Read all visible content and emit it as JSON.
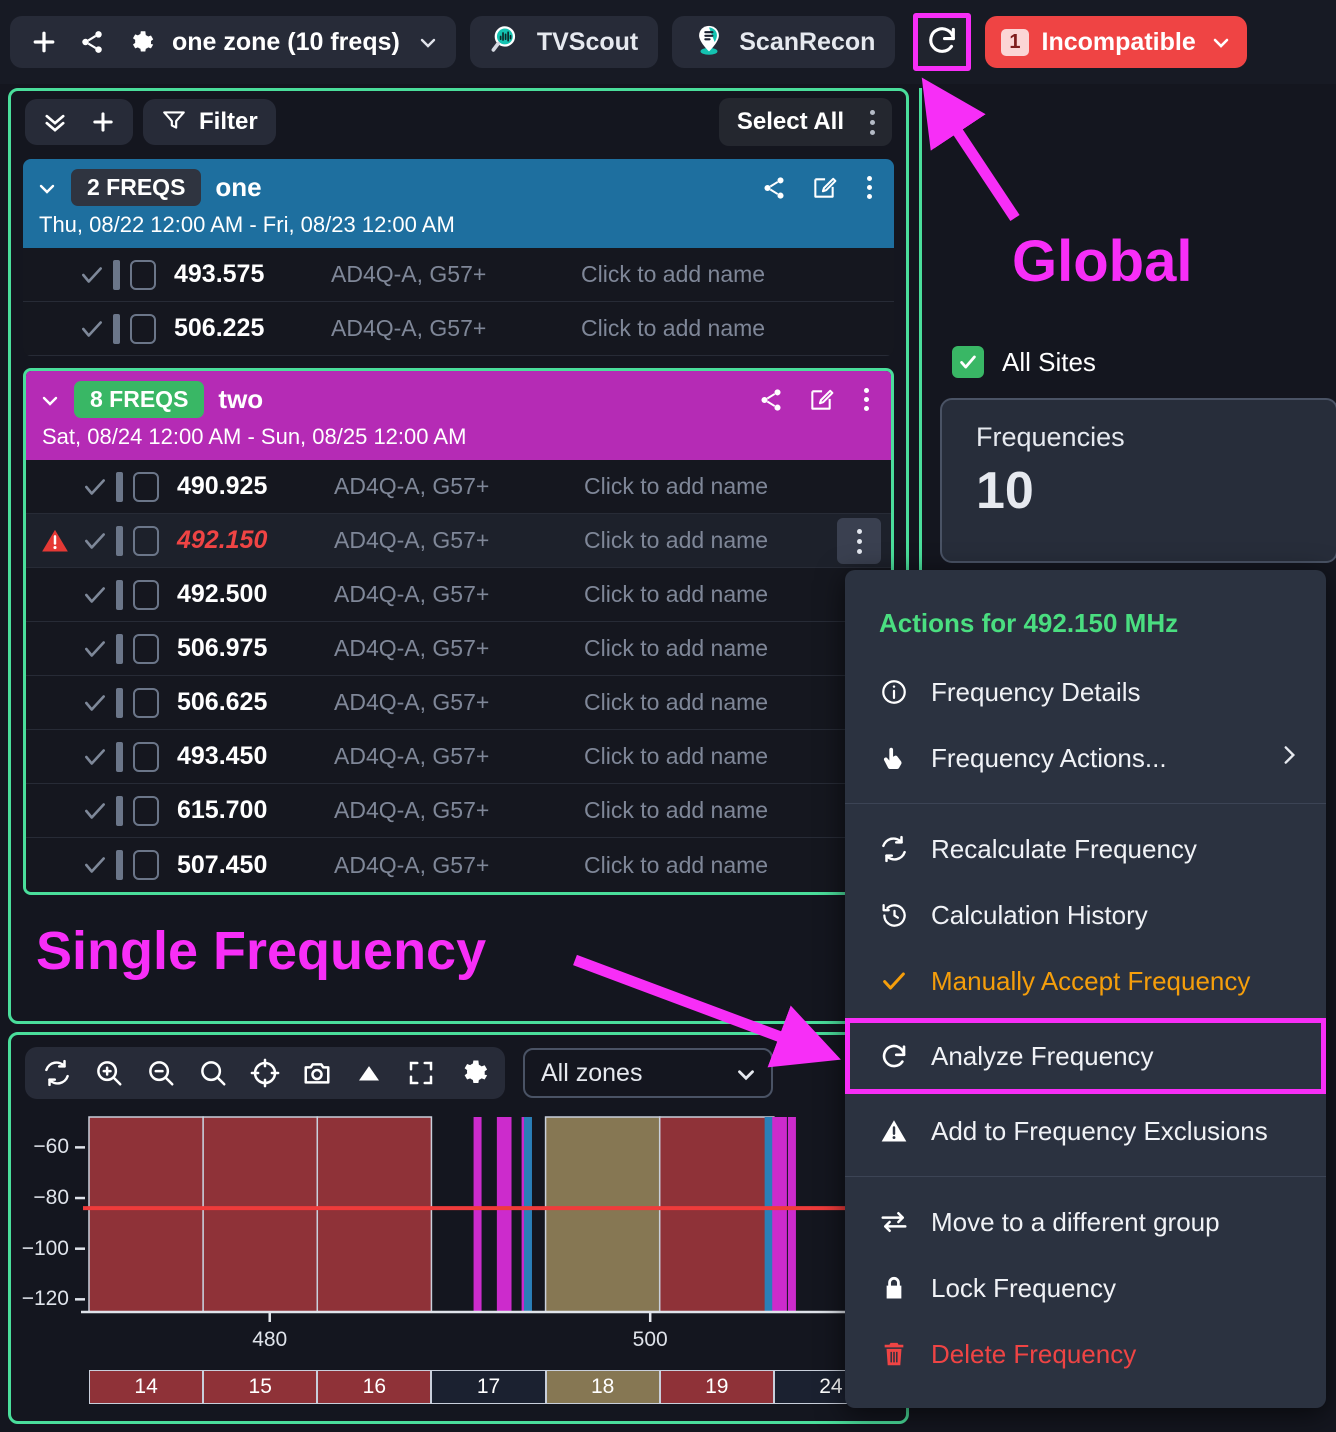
{
  "topbar": {
    "add_icon": "plus-icon",
    "share_icon": "share-icon",
    "settings_icon": "gear-icon",
    "zone_selector_label": "one zone (10 freqs)",
    "zone_selector_chevron": "chevron-down-icon",
    "tools": [
      {
        "label": "TVScout",
        "icon": "magnifier-waveform-icon"
      },
      {
        "label": "ScanRecon",
        "icon": "location-pin-signal-icon"
      }
    ],
    "refresh_icon": "refresh-icon",
    "incompatible": {
      "count": "1",
      "label": "Incompatible",
      "chevron": "chevron-down-icon",
      "color": "#ef4444"
    }
  },
  "list_toolbar": {
    "collapse_icon": "double-chevron-down-icon",
    "add_icon": "plus-icon",
    "filter_icon": "filter-icon",
    "filter_label": "Filter",
    "select_all_label": "Select All",
    "more_icon": "kebab-menu-icon"
  },
  "groups": [
    {
      "freq_count_label": "2 FREQS",
      "name": "one",
      "date_range": "Thu, 08/22 12:00 AM - Fri, 08/23 12:00 AM",
      "header_color": "#1e6f9f",
      "chip_style": "dark",
      "selected": false,
      "rows": [
        {
          "frequency": "493.575",
          "model": "AD4Q-A, G57+",
          "name_placeholder": "Click to add name",
          "warning": false
        },
        {
          "frequency": "506.225",
          "model": "AD4Q-A, G57+",
          "name_placeholder": "Click to add name",
          "warning": false
        }
      ]
    },
    {
      "freq_count_label": "8 FREQS",
      "name": "two",
      "date_range": "Sat, 08/24 12:00 AM - Sun, 08/25 12:00 AM",
      "header_color": "#b52bb5",
      "chip_style": "green",
      "selected": true,
      "rows": [
        {
          "frequency": "490.925",
          "model": "AD4Q-A, G57+",
          "name_placeholder": "Click to add name",
          "warning": false
        },
        {
          "frequency": "492.150",
          "model": "AD4Q-A, G57+",
          "name_placeholder": "Click to add name",
          "warning": true
        },
        {
          "frequency": "492.500",
          "model": "AD4Q-A, G57+",
          "name_placeholder": "Click to add name",
          "warning": false
        },
        {
          "frequency": "506.975",
          "model": "AD4Q-A, G57+",
          "name_placeholder": "Click to add name",
          "warning": false
        },
        {
          "frequency": "506.625",
          "model": "AD4Q-A, G57+",
          "name_placeholder": "Click to add name",
          "warning": false
        },
        {
          "frequency": "493.450",
          "model": "AD4Q-A, G57+",
          "name_placeholder": "Click to add name",
          "warning": false
        },
        {
          "frequency": "615.700",
          "model": "AD4Q-A, G57+",
          "name_placeholder": "Click to add name",
          "warning": false
        },
        {
          "frequency": "507.450",
          "model": "AD4Q-A, G57+",
          "name_placeholder": "Click to add name",
          "warning": false
        }
      ]
    }
  ],
  "right_panel": {
    "all_sites_label": "All Sites",
    "all_sites_checked": true,
    "frequencies_card": {
      "title": "Frequencies",
      "value": "10"
    }
  },
  "chart_toolbar": {
    "icons": [
      "refresh-icon",
      "zoom-in-icon",
      "zoom-out-icon",
      "search-icon",
      "crosshair-icon",
      "camera-icon",
      "triangle-icon",
      "fullscreen-icon",
      "gear-icon"
    ],
    "zones_select_label": "All zones",
    "zones_select_chevron": "chevron-down-icon"
  },
  "annotations": [
    {
      "text": "Global",
      "color": "#f72ef7"
    },
    {
      "text": "Single Frequency",
      "color": "#f72ef7"
    }
  ],
  "context_menu": {
    "title": "Actions for 492.150 MHz",
    "title_color": "#4ade80",
    "items": [
      {
        "label": "Frequency Details",
        "icon": "info-circle-icon",
        "style": "normal"
      },
      {
        "label": "Frequency Actions...",
        "icon": "pointer-hand-icon",
        "style": "normal",
        "submenu": true
      },
      {
        "separator": true
      },
      {
        "label": "Recalculate Frequency",
        "icon": "recalculate-icon",
        "style": "normal"
      },
      {
        "label": "Calculation History",
        "icon": "history-icon",
        "style": "normal"
      },
      {
        "label": "Manually Accept Frequency",
        "icon": "check-icon",
        "style": "orange"
      },
      {
        "label": "Analyze Frequency",
        "icon": "refresh-icon",
        "style": "normal",
        "highlighted": true
      },
      {
        "label": "Add to Frequency Exclusions",
        "icon": "warning-triangle-icon",
        "style": "normal"
      },
      {
        "separator": true
      },
      {
        "label": "Move to a different group",
        "icon": "swap-arrows-icon",
        "style": "normal"
      },
      {
        "label": "Lock Frequency",
        "icon": "lock-icon",
        "style": "normal"
      },
      {
        "label": "Delete Frequency",
        "icon": "trash-icon",
        "style": "red"
      }
    ]
  },
  "chart_data": {
    "type": "bar",
    "title": "",
    "xlabel": "",
    "ylabel": "",
    "xlim": [
      470.5,
      512.5
    ],
    "ylim": [
      -125,
      -48
    ],
    "yticks": [
      -60,
      -80,
      -100,
      -120
    ],
    "ytick_labels": [
      "−60",
      "−80",
      "−100",
      "−120"
    ],
    "xticks": [
      480,
      500
    ],
    "xtick_labels": [
      "480",
      "500"
    ],
    "threshold_line": {
      "value": -84,
      "color": "#ef3b3b"
    },
    "grid": false,
    "legend": null,
    "channel_blocks": [
      {
        "label": "14",
        "start": 470.5,
        "end": 476.5,
        "color": "#8f3238"
      },
      {
        "label": "15",
        "start": 476.5,
        "end": 482.5,
        "color": "#8f3238"
      },
      {
        "label": "16",
        "start": 482.5,
        "end": 488.5,
        "color": "#8f3238"
      },
      {
        "label": "17",
        "start": 488.5,
        "end": 494.5,
        "color": "#1b2130"
      },
      {
        "label": "18",
        "start": 494.5,
        "end": 500.5,
        "color": "#867753"
      },
      {
        "label": "19",
        "start": 500.5,
        "end": 506.5,
        "color": "#8f3238"
      },
      {
        "label": "24",
        "start": 506.5,
        "end": 512.5,
        "color": "#1b2130"
      }
    ],
    "frequency_markers": [
      {
        "freq": 490.925,
        "color": "#cc2bcc"
      },
      {
        "freq": 492.15,
        "color": "#cc2bcc"
      },
      {
        "freq": 492.5,
        "color": "#cc2bcc"
      },
      {
        "freq": 493.45,
        "color": "#cc2bcc"
      },
      {
        "freq": 493.575,
        "color": "#2a7fb8"
      },
      {
        "freq": 506.225,
        "color": "#2a7fb8"
      },
      {
        "freq": 506.625,
        "color": "#cc2bcc"
      },
      {
        "freq": 506.975,
        "color": "#cc2bcc"
      },
      {
        "freq": 507.45,
        "color": "#cc2bcc"
      }
    ]
  }
}
